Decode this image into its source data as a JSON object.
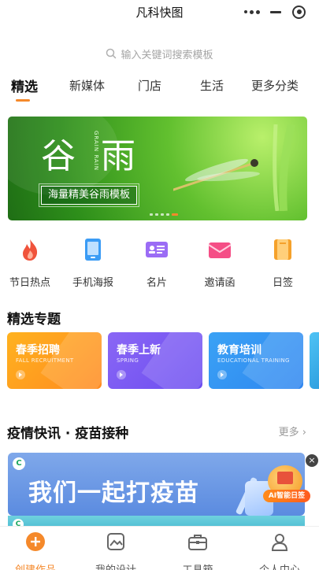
{
  "window": {
    "title": "凡科快图"
  },
  "search": {
    "placeholder": "输入关键词搜索模板",
    "icon": "search-icon"
  },
  "tabs": [
    {
      "label": "精选",
      "active": true
    },
    {
      "label": "新媒体",
      "active": false
    },
    {
      "label": "门店",
      "active": false
    },
    {
      "label": "生活",
      "active": false
    },
    {
      "label": "更多分类",
      "active": false
    }
  ],
  "banner": {
    "char1": "谷",
    "char2": "雨",
    "subtitle": "GRAIN RAIN",
    "caption": "海量精美谷雨模板",
    "indicator_count": 5,
    "indicator_active": 5
  },
  "categories": [
    {
      "label": "节日热点",
      "icon": "flame-icon",
      "color": "#f0533b"
    },
    {
      "label": "手机海报",
      "icon": "phone-icon",
      "color": "#3b9cf5"
    },
    {
      "label": "名片",
      "icon": "card-icon",
      "color": "#9b6cf5"
    },
    {
      "label": "邀请函",
      "icon": "envelope-icon",
      "color": "#f54e86"
    },
    {
      "label": "日签",
      "icon": "calendar-icon",
      "color": "#f5a12b"
    }
  ],
  "featured": {
    "title": "精选专题",
    "cards": [
      {
        "title": "春季招聘",
        "subtitle": "FALL RECRUITMENT",
        "color_from": "#ffb21f",
        "color_to": "#ff8a1f"
      },
      {
        "title": "春季上新",
        "subtitle": "SPRING",
        "color_from": "#8a67f5",
        "color_to": "#6b4cf0"
      },
      {
        "title": "教育培训",
        "subtitle": "EDUCATIONAL TRAINING",
        "color_from": "#3aa2f5",
        "color_to": "#2f86f0"
      }
    ]
  },
  "news": {
    "title": "疫情快讯 · 疫苗接种",
    "more": "更多",
    "banner_text": "我们一起打疫苗",
    "badge_letter": "C"
  },
  "ai_badge": {
    "label": "AI智能日签"
  },
  "close_label": "×",
  "bottom_nav": [
    {
      "label": "创建作品",
      "icon": "plus-circle-icon",
      "active": true
    },
    {
      "label": "我的设计",
      "icon": "image-icon",
      "active": false
    },
    {
      "label": "工具箱",
      "icon": "toolbox-icon",
      "active": false
    },
    {
      "label": "个人中心",
      "icon": "user-icon",
      "active": false
    }
  ],
  "colors": {
    "accent": "#f5892b"
  }
}
